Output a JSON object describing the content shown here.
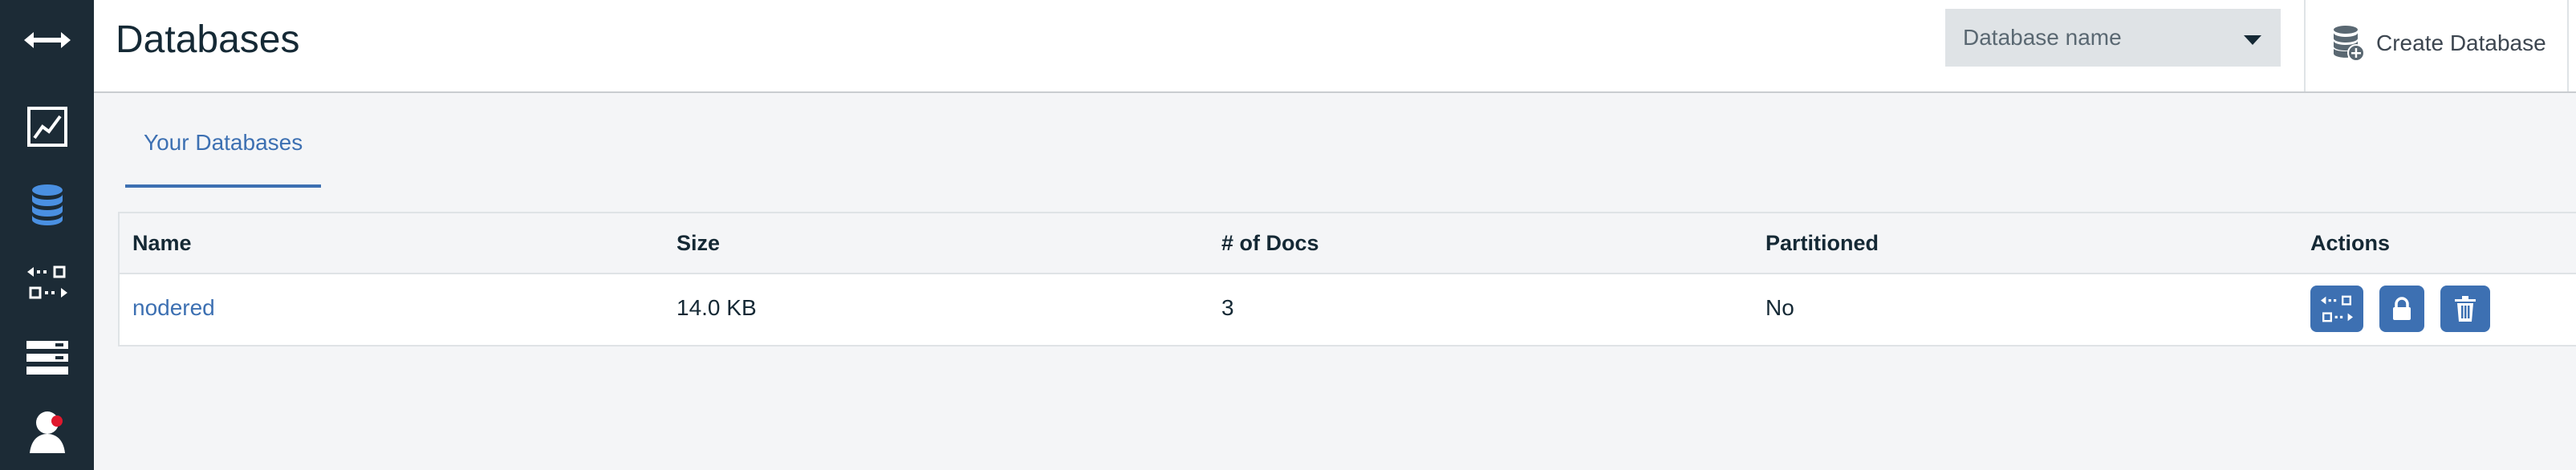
{
  "header": {
    "title": "Databases",
    "db_select_placeholder": "Database name",
    "create_label": "Create Database"
  },
  "sidebar": {
    "items": [
      {
        "icon": "expand-arrows-icon"
      },
      {
        "icon": "activity-chart-icon"
      },
      {
        "icon": "database-icon",
        "active": true
      },
      {
        "icon": "replication-icon"
      },
      {
        "icon": "server-list-icon"
      },
      {
        "icon": "user-icon",
        "notification": true
      }
    ]
  },
  "tabs": [
    {
      "label": "Your Databases",
      "active": true
    }
  ],
  "table": {
    "headers": [
      "Name",
      "Size",
      "# of Docs",
      "Partitioned",
      "Actions"
    ],
    "rows": [
      {
        "name": "nodered",
        "size": "14.0 KB",
        "docs": "3",
        "partitioned": "No",
        "actions": [
          "replicate-icon",
          "lock-icon",
          "trash-icon"
        ]
      }
    ]
  },
  "colors": {
    "sidebar_bg": "#1c2b36",
    "accent": "#3d70b2",
    "active_icon": "#4a90e2",
    "notification": "#e0182d"
  }
}
